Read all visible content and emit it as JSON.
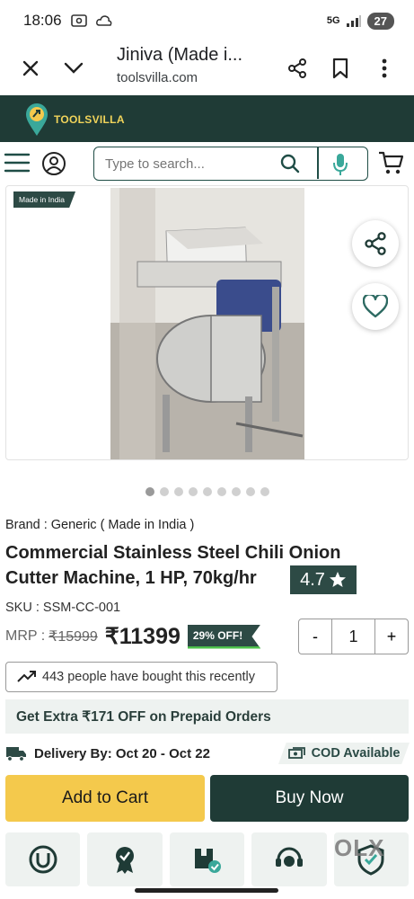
{
  "status_bar": {
    "time": "18:06",
    "network": "5G",
    "battery": "27"
  },
  "browser": {
    "title": "Jiniva (Made i...",
    "url": "toolsvilla.com"
  },
  "site": {
    "logo_text": "TOOLSVILLA",
    "brand_color": "#1f3b36",
    "accent_color": "#f4c94c"
  },
  "search": {
    "placeholder": "Type to search..."
  },
  "product": {
    "made_in_badge": "Made in India",
    "brand_line": "Brand : Generic ( Made in India )",
    "title": "Commercial Stainless Steel Chili Onion Cutter Machine, 1 HP, 70kg/hr",
    "rating": "4.7",
    "rating_icon": "star-icon",
    "sku": "SKU : SSM-CC-001",
    "mrp_label": "MRP :",
    "mrp_value": "₹15999",
    "price": "₹11399",
    "discount": "29% OFF!",
    "quantity": "1",
    "qty_minus": "-",
    "qty_plus": "+",
    "bought_text": "443 people have bought this recently",
    "prepaid_offer": "Get Extra ₹171 OFF on Prepaid Orders",
    "delivery": "Delivery By: Oct 20 - Oct 22",
    "cod": "COD Available"
  },
  "carousel": {
    "total_slides": 9,
    "active_index": 0
  },
  "actions": {
    "add_to_cart": "Add to Cart",
    "buy_now": "Buy Now"
  },
  "features": [
    {
      "icon": "shield-u-icon"
    },
    {
      "icon": "badge-check-icon"
    },
    {
      "icon": "box-check-icon"
    },
    {
      "icon": "support-agent-icon"
    },
    {
      "icon": "secure-shield-icon"
    }
  ],
  "watermark": "OLX"
}
